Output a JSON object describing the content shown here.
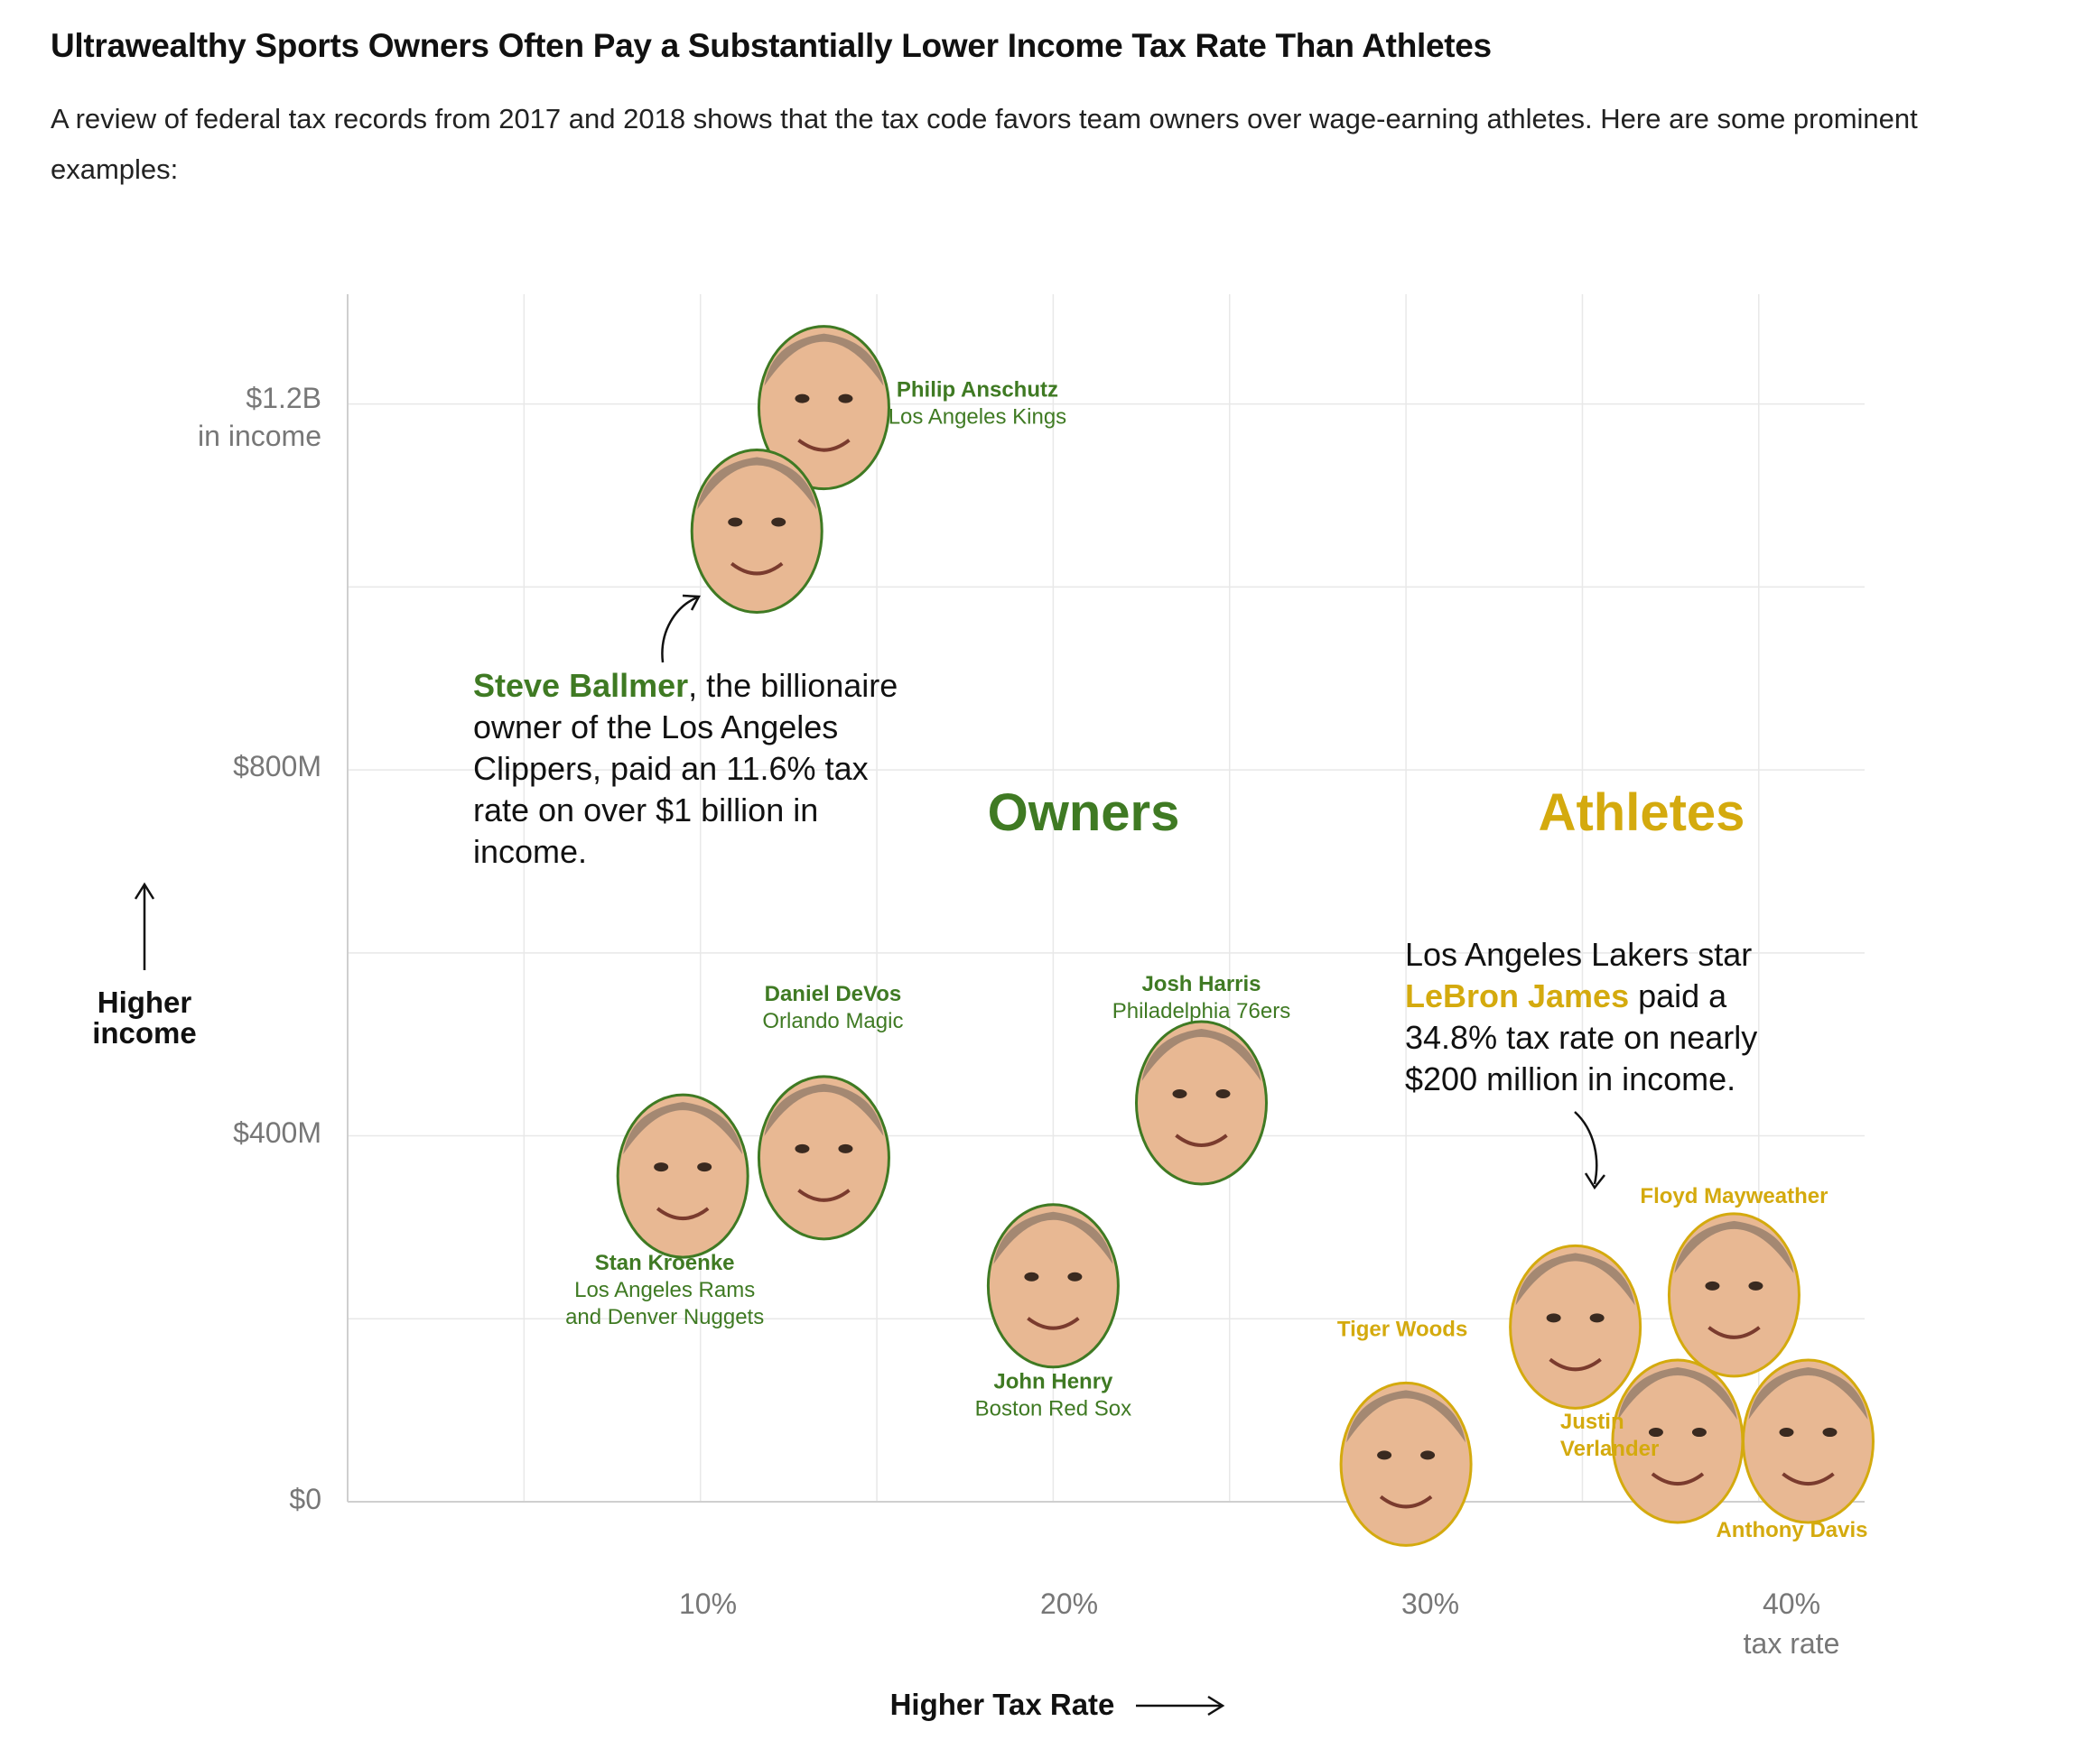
{
  "header": {
    "title": "Ultrawealthy Sports Owners Often Pay a Substantially Lower Income Tax Rate Than Athletes",
    "subtitle": "A review of federal tax records from 2017 and 2018 shows that the tax code favors team owners over wage-earning athletes. Here are some prominent examples:"
  },
  "colors": {
    "owners": "#3f7a23",
    "athletes": "#d4aa0e",
    "grid": "#e8e8e8",
    "axis": "#cfcfcf",
    "face": "#e8b893"
  },
  "chart_data": {
    "type": "scatter",
    "x_axis": {
      "label": "Higher Tax Rate",
      "ticks": [
        "10%",
        "20%",
        "30%",
        "40%"
      ],
      "tick_values": [
        10,
        20,
        30,
        40
      ],
      "unit_word": "tax rate",
      "range": [
        0,
        43
      ]
    },
    "y_axis": {
      "label_line1": "Higher",
      "label_line2": "income",
      "ticks": [
        "$0",
        "$400M",
        "$800M",
        "$1.2B"
      ],
      "tick_values": [
        0,
        400,
        800,
        1200
      ],
      "unit_word": "in income",
      "range": [
        0,
        1320
      ],
      "unit": "millions USD"
    },
    "group_labels": {
      "owners": "Owners",
      "athletes": "Athletes"
    },
    "series": [
      {
        "name": "Owners",
        "points": [
          {
            "name": "Philip Anschutz",
            "team": "Los Angeles Kings",
            "x": 13.5,
            "y": 1200
          },
          {
            "name": "Steve Ballmer",
            "team": "",
            "x": 11.6,
            "y": 1065
          },
          {
            "name": "Daniel DeVos",
            "team": "Orlando Magic",
            "x": 13.5,
            "y": 380
          },
          {
            "name": "Stan Kroenke",
            "team_line1": "Los Angeles Rams",
            "team_line2": "and Denver Nuggets",
            "x": 9.5,
            "y": 360
          },
          {
            "name": "John Henry",
            "team": "Boston Red Sox",
            "x": 20,
            "y": 240
          },
          {
            "name": "Josh Harris",
            "team": "Philadelphia 76ers",
            "x": 24.2,
            "y": 440
          }
        ]
      },
      {
        "name": "Athletes",
        "points": [
          {
            "name": "LeBron James",
            "x": 34.8,
            "y": 195
          },
          {
            "name": "Floyd Mayweather",
            "x": 39.3,
            "y": 230
          },
          {
            "name": "Tiger Woods",
            "x": 30,
            "y": 45
          },
          {
            "name": "Justin Verlander",
            "x": 37.7,
            "y": 70
          },
          {
            "name": "Anthony Davis",
            "x": 41.4,
            "y": 70
          }
        ]
      }
    ],
    "annotations": {
      "ballmer": {
        "highlight": "Steve Ballmer",
        "lines": [
          ", the billionaire",
          "owner of the Los Angeles",
          "Clippers, paid an 11.6% tax",
          "rate on over $1 billion in",
          "income."
        ]
      },
      "lebron": {
        "line1": "Los Angeles Lakers star",
        "highlight": "LeBron James",
        "line2_rest": " paid a",
        "lines": [
          "34.8% tax rate on nearly",
          "$200 million in income."
        ]
      }
    }
  }
}
